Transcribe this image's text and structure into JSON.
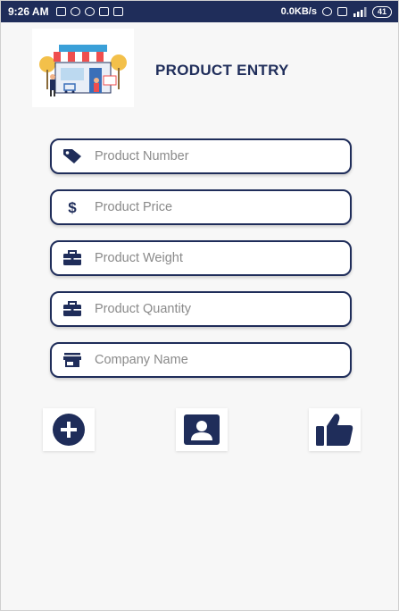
{
  "status_bar": {
    "time": "9:26 AM",
    "network_speed": "0.0KB/s",
    "battery": "41"
  },
  "header": {
    "title": "PRODUCT ENTRY",
    "logo_icon": "shop-storefront-illustration"
  },
  "form": {
    "fields": [
      {
        "placeholder": "Product Number",
        "value": "",
        "icon": "tag-icon"
      },
      {
        "placeholder": "Product Price",
        "value": "",
        "icon": "dollar-icon"
      },
      {
        "placeholder": "Product Weight",
        "value": "",
        "icon": "briefcase-icon"
      },
      {
        "placeholder": "Product Quantity",
        "value": "",
        "icon": "briefcase-icon"
      },
      {
        "placeholder": "Company Name",
        "value": "",
        "icon": "store-icon"
      }
    ]
  },
  "actions": [
    {
      "icon": "add-circle-icon"
    },
    {
      "icon": "contact-card-icon"
    },
    {
      "icon": "thumbs-up-icon"
    }
  ],
  "colors": {
    "primary": "#1f2d5a",
    "background": "#f7f7f7",
    "field_bg": "#ffffff",
    "placeholder": "#8a8a8a"
  }
}
